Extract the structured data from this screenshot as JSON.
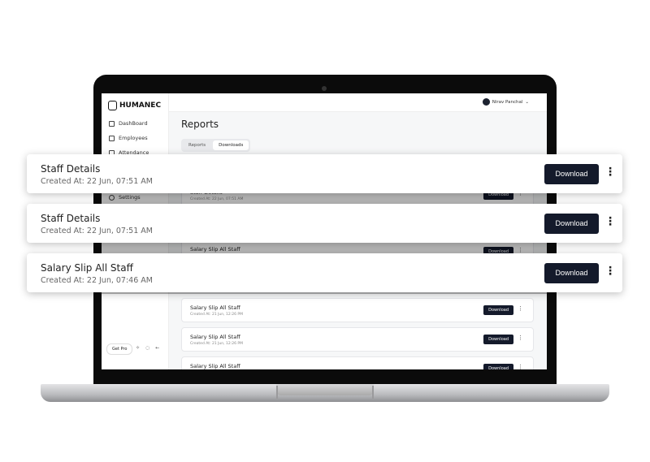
{
  "app": {
    "brand": "HUMANEC",
    "user": "Nirav Panchal"
  },
  "sidebar": {
    "items": [
      {
        "label": "DashBoard",
        "icon": "grid-icon"
      },
      {
        "label": "Employees",
        "icon": "users-icon"
      },
      {
        "label": "Attendance",
        "icon": "calendar-icon"
      },
      {
        "label": "Settings",
        "icon": "gear-icon"
      }
    ],
    "get_pro": "Get Pro"
  },
  "main": {
    "title": "Reports",
    "tabs": [
      {
        "label": "Reports"
      },
      {
        "label": "Downloads",
        "active": true
      }
    ],
    "items": [
      {
        "name": "Staff Details",
        "date": "Created At: 22 Jun, 07:51 AM"
      },
      {
        "name": "Salary Slip All Staff",
        "date": ""
      },
      {
        "name": "Salary Slip All Staff",
        "date": "Created At: 21 Jun, 12:26 PM"
      },
      {
        "name": "Salary Slip All Staff",
        "date": "Created At: 21 Jun, 12:26 PM"
      },
      {
        "name": "Salary Slip All Staff",
        "date": ""
      }
    ],
    "download_label": "Download"
  },
  "cards": [
    {
      "name": "Staff Details",
      "date": "Created At: 22 Jun, 07:51 AM"
    },
    {
      "name": "Staff Details",
      "date": "Created At: 22 Jun, 07:51 AM"
    },
    {
      "name": "Salary Slip All Staff",
      "date": "Created At: 22 Jun, 07:46 AM"
    }
  ],
  "colors": {
    "button": "#141a2b"
  }
}
